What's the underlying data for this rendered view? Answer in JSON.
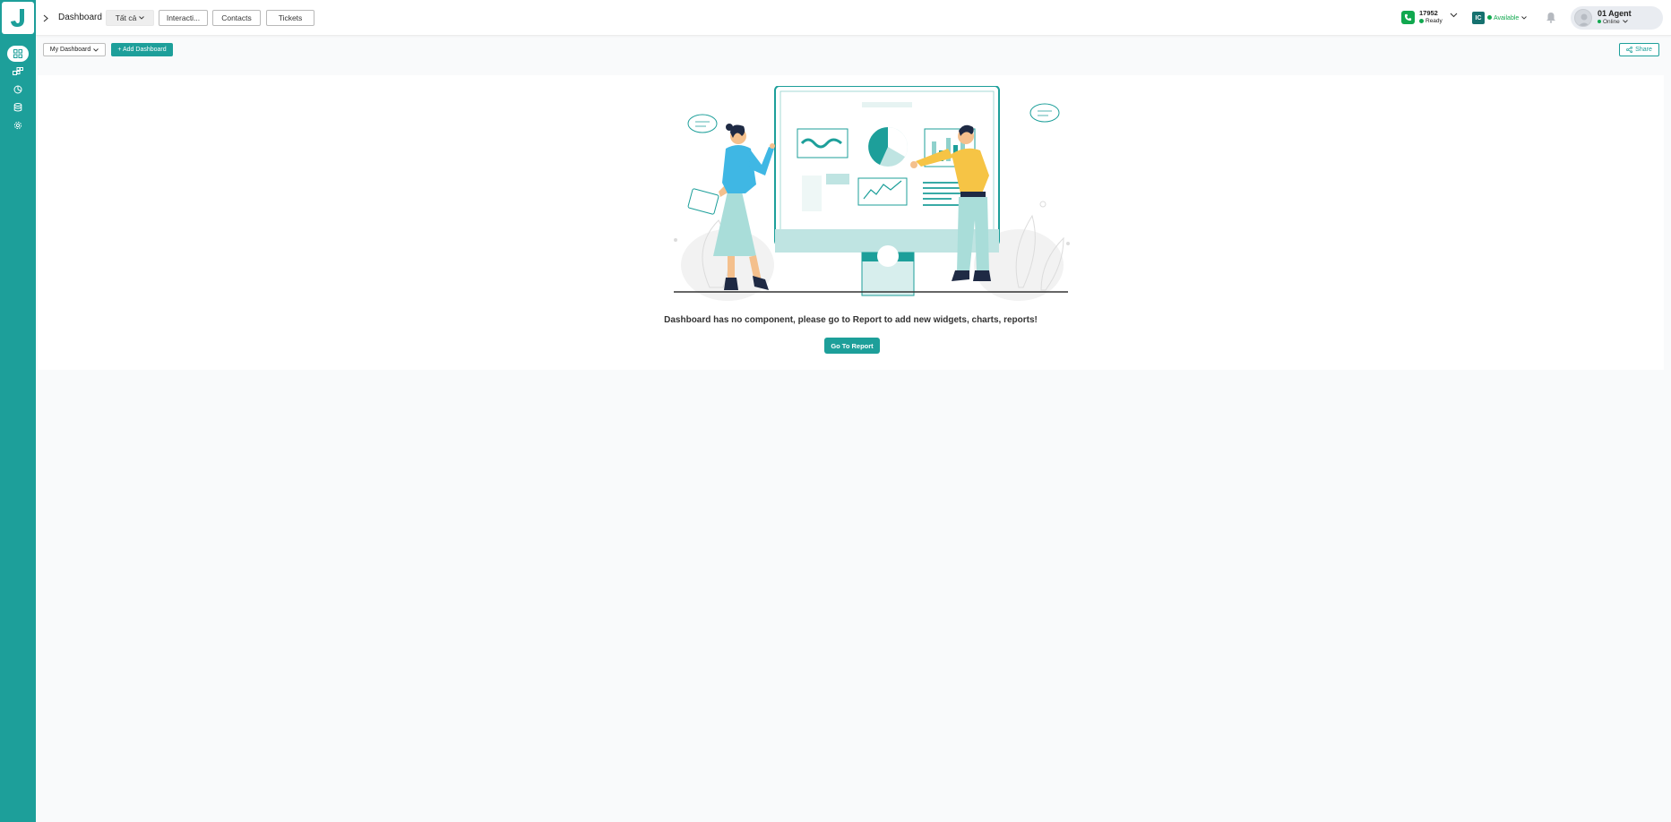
{
  "app": {
    "brand_color": "#1d9f9a"
  },
  "sidebar": {
    "items": [
      {
        "icon": "dashboard-grid-icon",
        "active": true
      },
      {
        "icon": "modules-icon",
        "active": false
      },
      {
        "icon": "report-pie-icon",
        "active": false
      },
      {
        "icon": "database-icon",
        "active": false
      },
      {
        "icon": "settings-gear-icon",
        "active": false
      }
    ]
  },
  "header": {
    "title": "Dashboard",
    "tabs": [
      {
        "label": "Tất cả"
      },
      {
        "label": "Interacti..."
      },
      {
        "label": "Contacts"
      },
      {
        "label": "Tickets"
      }
    ],
    "phone": {
      "extension": "17952",
      "status": "Ready"
    },
    "availability": {
      "badge": "IC",
      "label": "Available"
    },
    "user": {
      "name": "01 Agent",
      "state": "Online"
    }
  },
  "toolbar": {
    "dashboard_select": "My Dashboard",
    "add_label": "+ Add Dashboard",
    "share_label": "Share"
  },
  "main": {
    "empty_message": "Dashboard has no component, please go to Report to add new widgets, charts, reports!",
    "go_to_report_label": "Go To Report"
  }
}
